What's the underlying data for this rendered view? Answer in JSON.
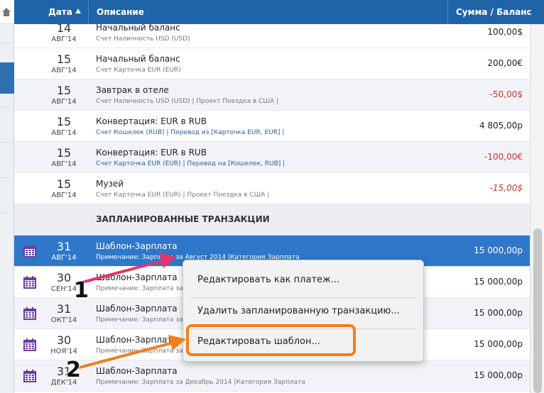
{
  "header": {
    "date_label": "Дата",
    "description_label": "Описание",
    "amount_label": "Сумма / Баланс"
  },
  "transactions": [
    {
      "day": "14",
      "month": "АВГ'14",
      "title": "Начальный баланс",
      "sub": "Счет Наличность USD (USD)",
      "amount": "100,00$",
      "amount_color": "#222222"
    },
    {
      "day": "15",
      "month": "АВГ'14",
      "title": "Начальный баланс",
      "sub": "Счет Карточка EUR (EUR)",
      "amount": "200,00€",
      "amount_color": "#222222"
    },
    {
      "day": "15",
      "month": "АВГ'14",
      "title": "Завтрак в отеле",
      "sub": "Счет Наличность USD (USD) | Проект Поездка в США |",
      "amount": "-50,00$",
      "amount_color": "#c0392b"
    },
    {
      "day": "15",
      "month": "АВГ'14",
      "title": "Конвертация: EUR в RUB",
      "sub": "Счет Кошелек (RUB) | Перевод из [Карточка EUR, EUR] |",
      "amount": "4 805,00р",
      "amount_color": "#222222"
    },
    {
      "day": "15",
      "month": "АВГ'14",
      "title": "Конвертация: EUR в RUB",
      "sub": "Счет Карточка EUR (EUR) | Перевод на [Кошелек, RUB] |",
      "amount": "-100,00€",
      "amount_color": "#c0392b"
    },
    {
      "day": "15",
      "month": "АВГ'14",
      "title": "Музей",
      "sub": "Счет Карточка EUR (EUR) | Проект Поездка в США |",
      "amount": "-15,00$",
      "amount_color": "#c0392b"
    }
  ],
  "scheduled_section": "ЗАПЛАНИРОВАННЫЕ ТРАНЗАКЦИИ",
  "scheduled": [
    {
      "day": "31",
      "month": "АВГ'14",
      "title": "Шаблон-Зарплата",
      "sub": "Примечание: Зарплата за Август 2014 |Категория Зарплата",
      "amount": "15 000,00р",
      "selected": true
    },
    {
      "day": "30",
      "month": "СЕН'14",
      "title": "Шаблон-Зарплата",
      "sub": "Примечание: Зарплата за Сентябрь 2014 |Категория Зарплата",
      "amount": "15 000,00р"
    },
    {
      "day": "31",
      "month": "ОКТ'14",
      "title": "Шаблон-Зарплата",
      "sub": "Примечание: Зарплата за Октябрь 2014 |Категория Зарплата",
      "amount": "15 000,00р"
    },
    {
      "day": "30",
      "month": "НОЯ'14",
      "title": "Шаблон-Зарплата",
      "sub": "Примечание: Зарплата за Ноябрь 2014 |Категория Зарплата",
      "amount": "15 000,00р"
    },
    {
      "day": "31",
      "month": "ДЕК'14",
      "title": "Шаблон-Зарплата",
      "sub": "Примечание: Зарплата за Декабрь 2014 |Категория Зарплата",
      "amount": "15 000,00р"
    }
  ],
  "context_menu": {
    "items": [
      "Редактировать как платеж...",
      "Удалить запланированную транзакцию...",
      "Редактировать шаблон..."
    ]
  },
  "callouts": [
    "1",
    "2"
  ],
  "colors": {
    "header": "#1f64a8",
    "selected_row": "#2f78c9",
    "highlight": "#f07f1d",
    "arrow_1": "#e8336d",
    "arrow_2": "#f07f1d",
    "calendar": "#6a3d9a"
  }
}
